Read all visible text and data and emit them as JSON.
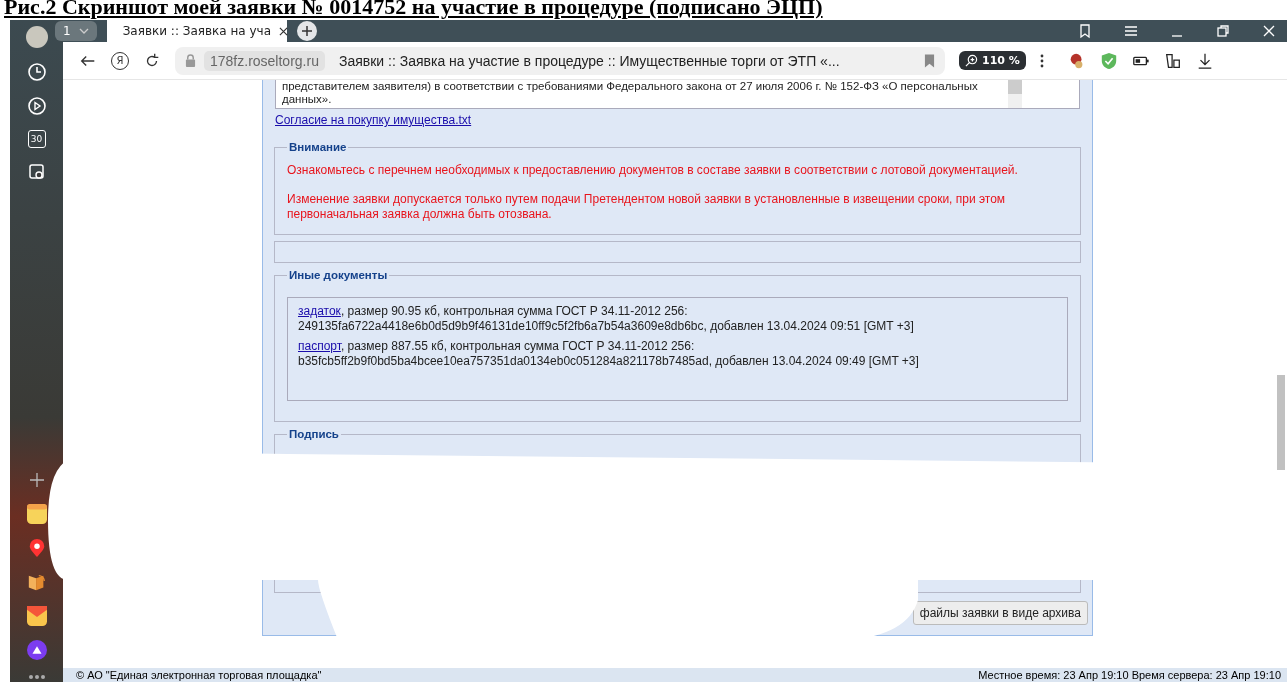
{
  "caption": "Рис.2 Скриншот моей заявки № 0014752 на участие в процедуре (подписано ЭЦП)",
  "browser": {
    "tab_count": "1",
    "home_letter": "Я",
    "tabs": [
      {
        "title": "Заявки :: Заявка на уча",
        "selected": true
      }
    ],
    "url": "178fz.roseltorg.ru",
    "page_title": "Заявки :: Заявка на участие в процедуре :: Имущественные торги от ЭТП «...",
    "zoom": "110 %"
  },
  "sidebar": {
    "calendar_day": "30"
  },
  "page": {
    "consent_text": "представителем заявителя) в соответствии с требованиями Федерального закона от 27 июля 2006 г. № 152-ФЗ «О персональных данных».",
    "consent_link": "Согласие на покупку имущества.txt",
    "attention": {
      "title": "Внимание",
      "messages": [
        "Ознакомьтесь с перечнем необходимых к предоставлению документов в составе заявки в соответствии с лотовой документацией.",
        "Изменение заявки допускается только путем подачи Претендентом новой заявки в установленные в извещении сроки, при этом первоначальная заявка должна быть отозвана."
      ]
    },
    "other_docs": {
      "title": "Иные документы",
      "files": [
        {
          "name": "задаток",
          "details": ", размер 90.95 кб, контрольная сумма ГОСТ Р 34.11-2012 256:",
          "hash_line": "249135fa6722a4418e6b0d5d9b9f46131de10ff9c5f2fb6a7b54a3609e8db6bc, добавлен 13.04.2024 09:51 [GMT +3]"
        },
        {
          "name": "паспорт",
          "details": ", размер 887.55 кб, контрольная сумма ГОСТ Р 34.11-2012 256:",
          "hash_line": "b35fcb5ff2b9f0bd5ba4bcee10ea757351da0134eb0c051284a821178b7485ad, добавлен 13.04.2024 09:49 [GMT +3]"
        }
      ]
    },
    "signature": {
      "title": "Подпись"
    },
    "archive_button": "файлы заявки в виде архива"
  },
  "status_bar": {
    "copyright": "© АО \"Единая электронная торговая площадка\"",
    "time": "Местное время: 23 Апр 19:10 Время сервера: 23 Апр 19:10"
  }
}
